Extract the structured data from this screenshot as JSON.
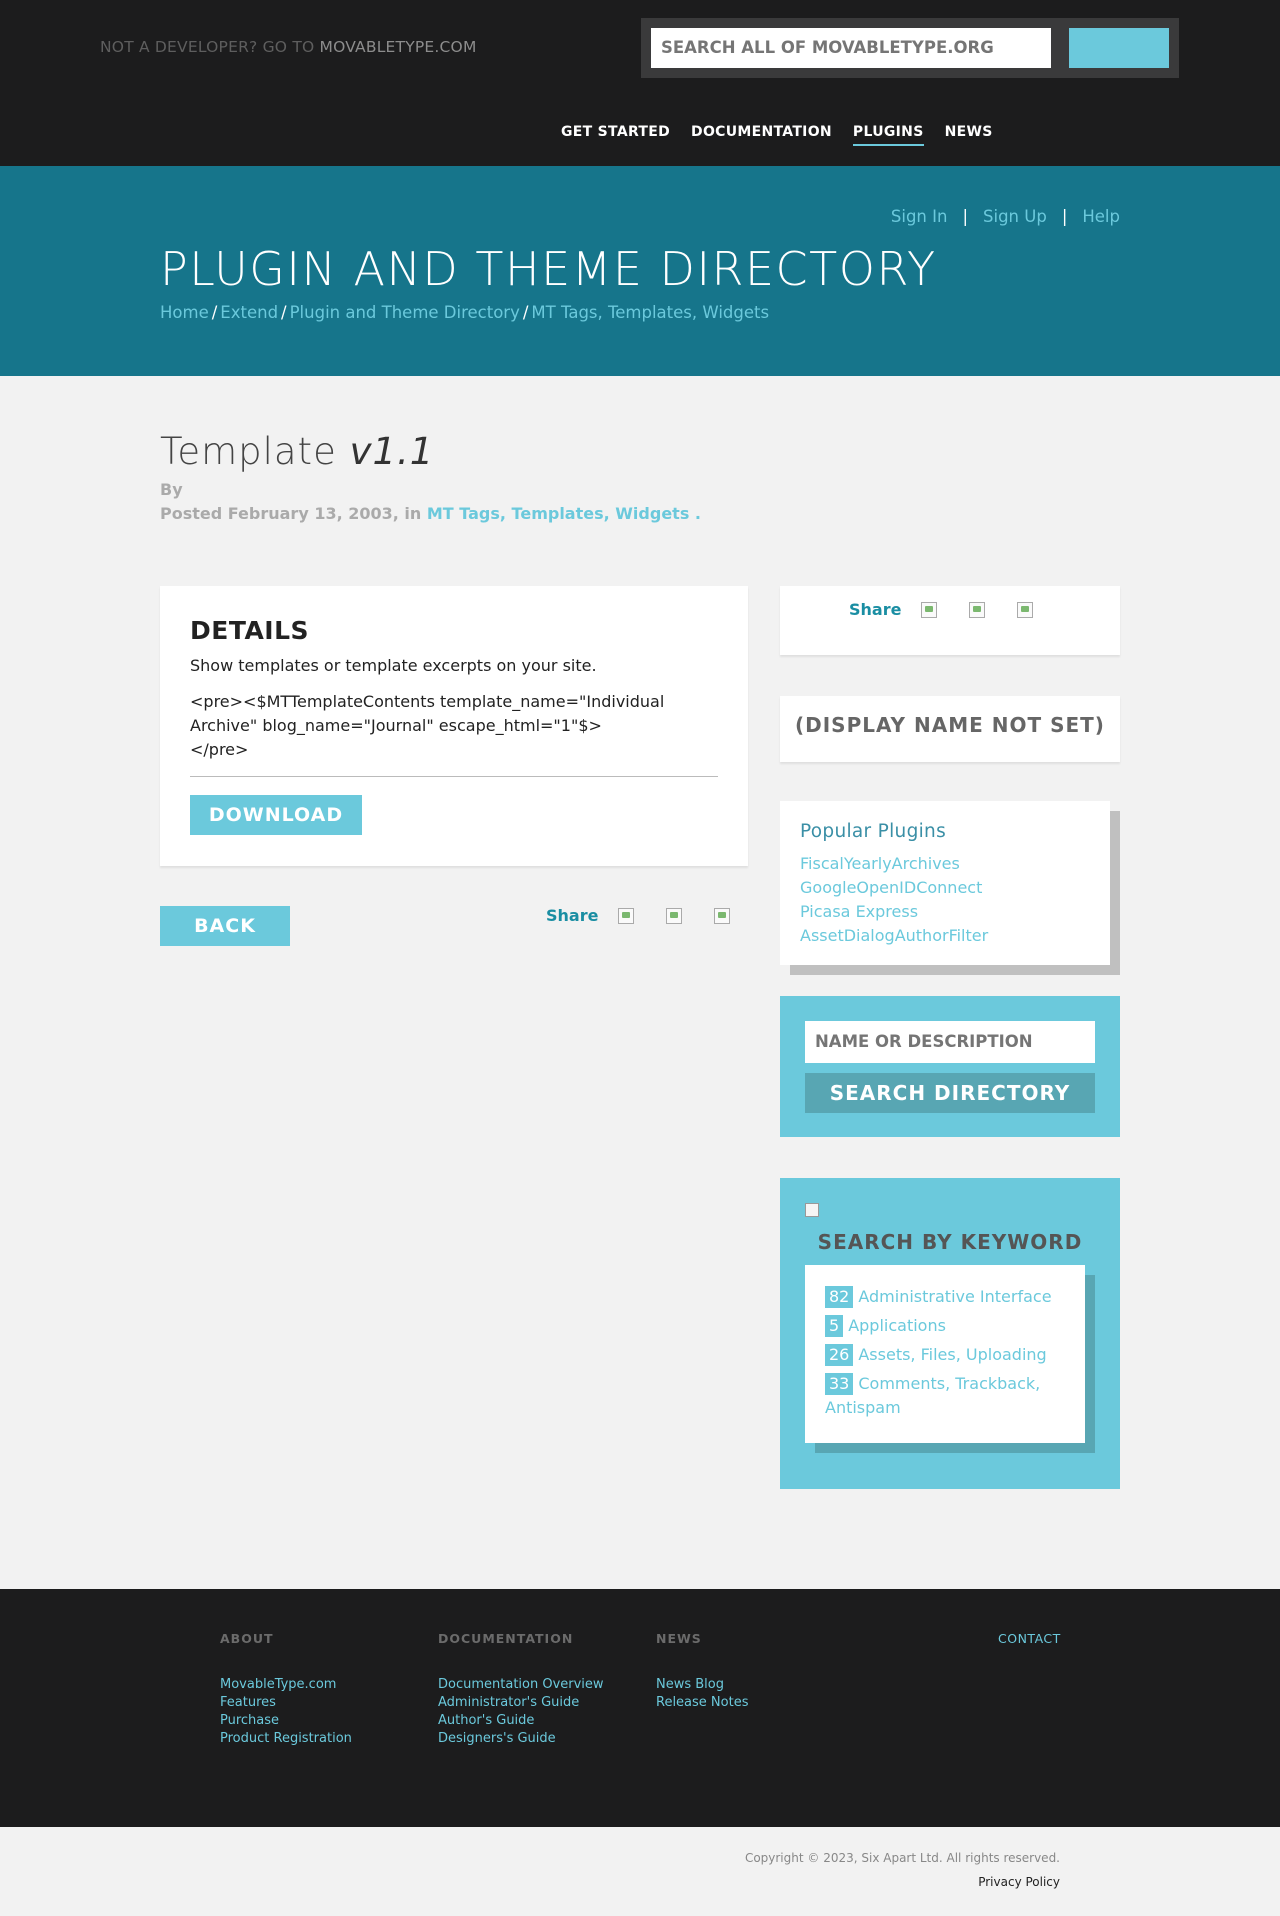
{
  "topbar": {
    "not_dev_prefix": "NOT A DEVELOPER? GO TO",
    "not_dev_link": "MOVABLETYPE.COM",
    "search_placeholder": "SEARCH ALL OF MOVABLETYPE.ORG",
    "nav": [
      "GET STARTED",
      "DOCUMENTATION",
      "PLUGINS",
      "NEWS"
    ]
  },
  "hero": {
    "account_links": [
      "Sign In",
      "Sign Up",
      "Help"
    ],
    "separator": "|",
    "title": "PLUGIN AND THEME DIRECTORY",
    "breadcrumb": [
      "Home",
      "Extend",
      "Plugin and Theme Directory",
      "MT Tags, Templates, Widgets"
    ],
    "breadcrumb_sep": "/"
  },
  "entry": {
    "name": "Template",
    "version": "v1.1",
    "by": "By",
    "posted_prefix": "Posted February 13, 2003, in",
    "categories": "MT Tags, Templates, Widgets",
    "posted_suffix": "."
  },
  "details": {
    "heading": "DETAILS",
    "description": "Show templates or template excerpts on your site.",
    "code": "<pre><$MTTemplateContents template_name=\"Individual Archive\" blog_name=\"Journal\" escape_html=\"1\"$>\n</pre>",
    "download_label": "DOWNLOAD"
  },
  "back_label": "BACK",
  "share_label": "Share",
  "sidebar": {
    "display_name": "(DISPLAY NAME NOT SET)",
    "popular_title": "Popular Plugins",
    "popular": [
      "FiscalYearlyArchives",
      "GoogleOpenIDConnect",
      "Picasa Express",
      "AssetDialogAuthorFilter"
    ],
    "dir_placeholder": "NAME OR DESCRIPTION",
    "dir_button": "SEARCH DIRECTORY",
    "keyword_title": "SEARCH BY KEYWORD",
    "keywords": [
      {
        "count": "82",
        "label": "Administrative Interface"
      },
      {
        "count": "5",
        "label": "Applications"
      },
      {
        "count": "26",
        "label": "Assets, Files, Uploading"
      },
      {
        "count": "33",
        "label": "Comments, Trackback, Antispam"
      }
    ]
  },
  "footer": {
    "about": {
      "heading": "ABOUT",
      "links": [
        "MovableType.com",
        "Features",
        "Purchase",
        "Product Registration"
      ]
    },
    "docs": {
      "heading": "DOCUMENTATION",
      "links": [
        "Documentation Overview",
        "Administrator's Guide",
        "Author's Guide",
        "Designers's Guide"
      ]
    },
    "news": {
      "heading": "NEWS",
      "links": [
        "News Blog",
        "Release Notes"
      ]
    },
    "contact": "CONTACT",
    "copyright": "Copyright © 2023, Six Apart Ltd. All rights reserved.",
    "privacy": "Privacy Policy"
  },
  "colors": {
    "accent": "#6bc9dc",
    "hero": "#16758b",
    "dark": "#1c1c1d",
    "background": "#f2f2f2"
  }
}
